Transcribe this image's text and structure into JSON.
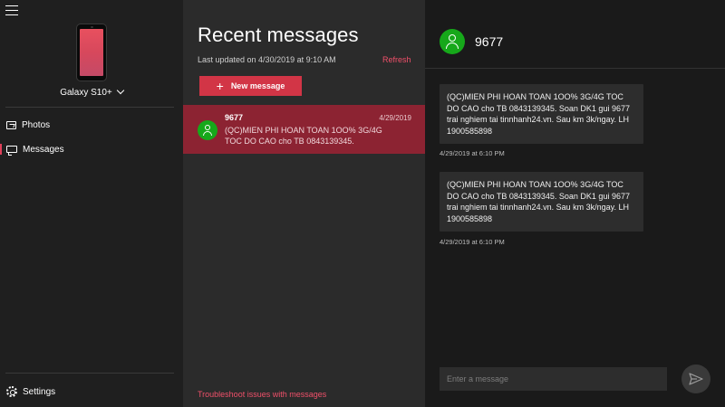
{
  "nav": {
    "device_name": "Galaxy S10+",
    "items": [
      {
        "label": "Photos",
        "icon": "photos-icon"
      },
      {
        "label": "Messages",
        "icon": "messages-icon",
        "active": true
      }
    ],
    "settings_label": "Settings"
  },
  "list": {
    "title": "Recent messages",
    "updated": "Last updated on 4/30/2019 at 9:10 AM",
    "refresh": "Refresh",
    "new_message": "New message",
    "conversation": {
      "name": "9677",
      "date": "4/29/2019",
      "preview": "(QC)MIEN PHI HOAN TOAN 1OO% 3G/4G TOC DO CAO cho TB 0843139345."
    },
    "troubleshoot": "Troubleshoot issues with messages"
  },
  "thread": {
    "name": "9677",
    "messages": [
      {
        "text": "(QC)MIEN PHI HOAN TOAN 1OO% 3G/4G TOC DO CAO cho TB 0843139345. Soan DK1 gui 9677 trai nghiem tai tinnhanh24.vn. Sau km 3k/ngay. LH 1900585898",
        "time": "4/29/2019 at 6:10 PM"
      },
      {
        "text": "(QC)MIEN PHI HOAN TOAN 1OO% 3G/4G TOC DO CAO cho TB 0843139345. Soan DK1 gui 9677 trai nghiem tai tinnhanh24.vn. Sau km 3k/ngay. LH 1900585898",
        "time": "4/29/2019 at 6:10 PM"
      }
    ],
    "composer_placeholder": "Enter a message"
  },
  "colors": {
    "accent": "#d23546",
    "selected_conversation": "#8c2332",
    "avatar": "#16a81a",
    "link": "#f0506a"
  }
}
